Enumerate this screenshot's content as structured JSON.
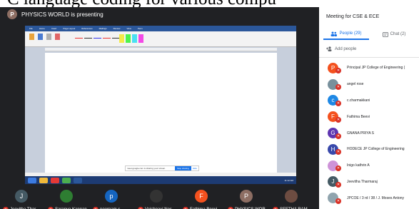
{
  "caption": "C language coding for various compu",
  "presenter": {
    "initial": "P",
    "text": "PHYSICS WORLD is presenting",
    "avatar_color": "#8d6e63"
  },
  "shared_screen": {
    "ribbon_tabs": [
      "File",
      "Home",
      "Insert",
      "Page Layout",
      "References",
      "Mailings",
      "Review",
      "View",
      "Pens"
    ],
    "share_banner": "meet.google.com is sharing your screen.",
    "stop_sharing": "Stop sharing",
    "hide": "Hide",
    "taskbar_time": "11:12 AM"
  },
  "participants_strip": [
    {
      "initial": "J",
      "name": "Jeevitha Thar...",
      "color": "#455a64"
    },
    {
      "initial": "",
      "name": "Saranya Kannan",
      "color": "#2e7d32"
    },
    {
      "initial": "p",
      "name": "poornam s",
      "color": "#1565c0"
    },
    {
      "initial": "",
      "name": "Vaishnavi Nes...",
      "color": "#333333"
    },
    {
      "initial": "F",
      "name": "Fathima Beevi",
      "color": "#f4511e"
    },
    {
      "initial": "P",
      "name": "PHYSICS WOR...",
      "color": "#8d6e63"
    },
    {
      "initial": "",
      "name": "SEETHA RAM...",
      "color": "#6d4c41"
    }
  ],
  "panel": {
    "title": "Meeting for CSE & ECE",
    "tab_people": "People (29)",
    "tab_chat": "Chat (2)",
    "add_people": "Add people",
    "list": [
      {
        "initial": "P",
        "name": "Principal JP College of Engineering (",
        "color": "#f4511e"
      },
      {
        "initial": "",
        "name": "angel rose",
        "color": "#78909c"
      },
      {
        "initial": "c",
        "name": "c.charmakkani",
        "color": "#1e88e5"
      },
      {
        "initial": "F",
        "name": "Fathima Beevi",
        "color": "#f4511e"
      },
      {
        "initial": "G",
        "name": "GNANA PRIYA S",
        "color": "#5e35b1"
      },
      {
        "initial": "H",
        "name": "HODECE JP College of Engineering",
        "color": "#3949ab"
      },
      {
        "initial": "",
        "name": "Inigo kathrin A",
        "color": "#ce93d8"
      },
      {
        "initial": "J",
        "name": "Jeevitha Tharmaraj",
        "color": "#455a64"
      },
      {
        "initial": "",
        "name": "JPCOE / 3 rd / 38 / J. Moses Antony",
        "color": "#90a4ae"
      }
    ]
  }
}
